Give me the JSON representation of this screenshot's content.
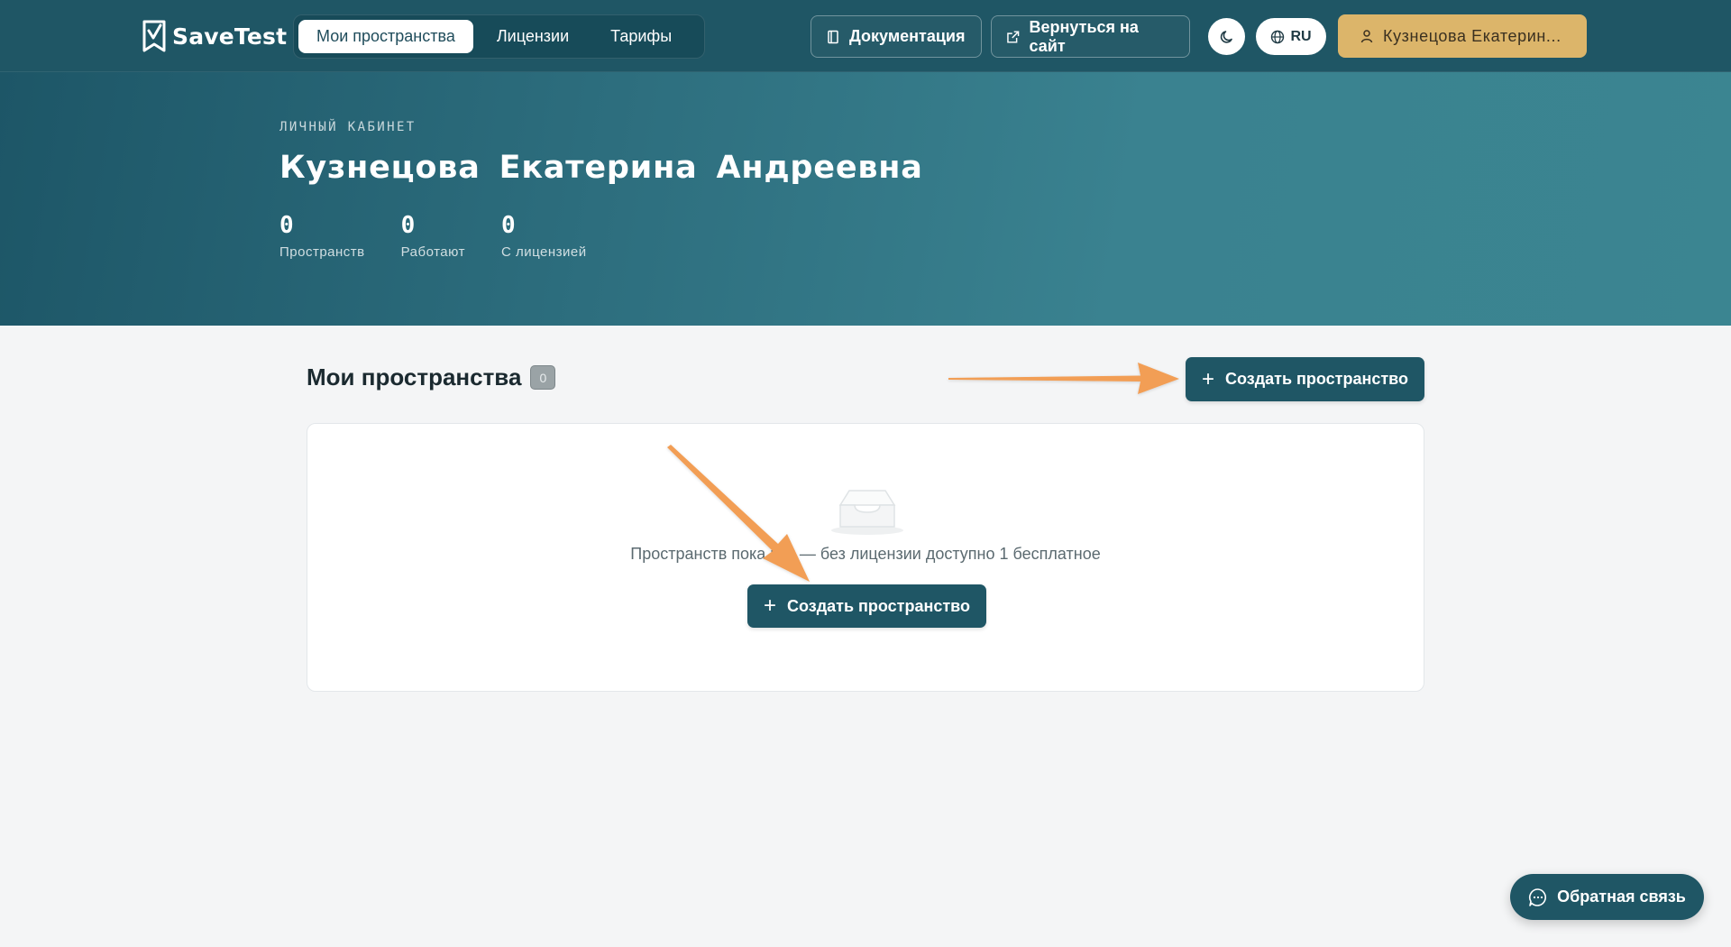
{
  "header": {
    "logo_text": "SaveTest",
    "nav_tabs": [
      {
        "label": "Мои пространства",
        "active": true
      },
      {
        "label": "Лицензии",
        "active": false
      },
      {
        "label": "Тарифы",
        "active": false
      }
    ],
    "docs_label": "Документация",
    "back_label": "Вернуться на сайт",
    "theme_icon": "moon-icon",
    "lang_label": "RU",
    "user_label": "Кузнецова Екатерин..."
  },
  "hero": {
    "kicker": "ЛИЧНЫЙ КАБИНЕТ",
    "name": "Кузнецова Екатерина Андреевна",
    "stats": [
      {
        "value": "0",
        "label": "Пространств"
      },
      {
        "value": "0",
        "label": "Работают"
      },
      {
        "value": "0",
        "label": "С лицензией"
      }
    ]
  },
  "section": {
    "title": "Мои пространства",
    "count": "0",
    "create_label": "Создать пространство"
  },
  "empty_state": {
    "icon": "inbox-icon",
    "text": "Пространств пока нет — без лицензии доступно 1 бесплатное",
    "create_label": "Создать пространство"
  },
  "feedback": {
    "label": "Обратная связь"
  },
  "colors": {
    "brand": "#1f5665",
    "accent_user": "#dcb56a",
    "annotation_arrow": "#f29e55"
  }
}
